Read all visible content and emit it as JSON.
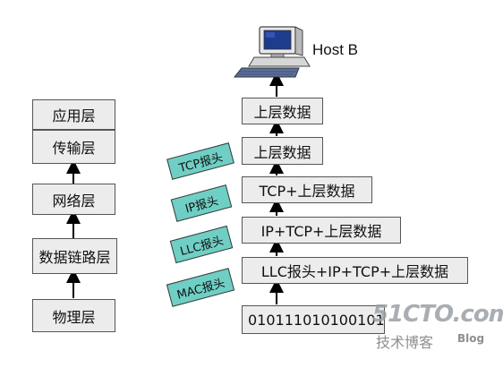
{
  "osi_layers": {
    "application": "应用层",
    "transport": "传输层",
    "network": "网络层",
    "datalink": "数据链路层",
    "physical": "物理层"
  },
  "host": {
    "label": "Host B",
    "icon": "computer-icon"
  },
  "stack": {
    "row1": "上层数据",
    "row2": "上层数据",
    "row3": "TCP+上层数据",
    "row4": "IP+TCP+上层数据",
    "row5": "LLC报头+IP+TCP+上层数据",
    "row6": "010111010100101"
  },
  "headers": {
    "tcp": "TCP报头",
    "ip": "IP报头",
    "llc": "LLC报头",
    "mac": "MAC报头"
  },
  "watermark": {
    "site": "51CTO.com",
    "sub": "技术博客",
    "blog": "Blog"
  },
  "colors": {
    "box_fill": "#ececec",
    "header_fill": "#6fcfc5",
    "arrow": "#000000"
  }
}
